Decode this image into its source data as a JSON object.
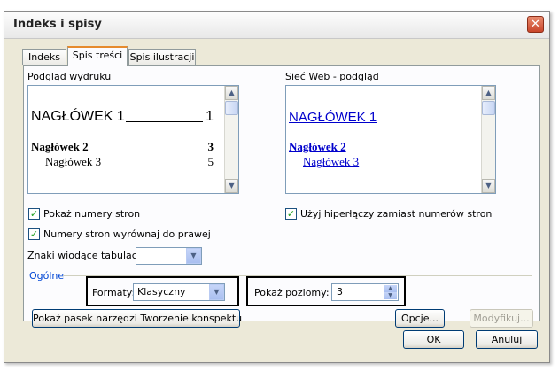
{
  "window": {
    "title": "Indeks i spisy",
    "close_glyph": "✕"
  },
  "tabs": [
    {
      "label": "Indeks",
      "active": false
    },
    {
      "label": "Spis treści",
      "active": true
    },
    {
      "label": "Spis ilustracji",
      "active": false
    }
  ],
  "print_preview": {
    "label": "Podgląd wydruku",
    "h1_text": "NAGŁÓWEK 1",
    "h1_page": "1",
    "h2_text": "Nagłówek 2",
    "h2_page": "3",
    "h3_text": "Nagłówek 3",
    "h3_page": "5"
  },
  "web_preview": {
    "label": "Sieć Web - podgląd",
    "h1_text": "NAGŁÓWEK 1",
    "h2_text": "Nagłówek 2",
    "h3_text": "Nagłówek 3",
    "link_color": "#0000cc"
  },
  "options": {
    "show_page_numbers": {
      "label": "Pokaż numery stron",
      "checked": true
    },
    "right_align": {
      "label": "Numery stron wyrównaj do prawej",
      "checked": true
    },
    "use_hyperlinks": {
      "label": "Użyj hiperłączy zamiast numerów stron",
      "checked": true
    },
    "tab_leader": {
      "label": "Znaki wiodące tabulacji:"
    }
  },
  "general": {
    "group_label": "Ogólne",
    "formats_label": "Formaty:",
    "formats_value": "Klasyczny",
    "levels_label": "Pokaż poziomy:",
    "levels_value": "3"
  },
  "buttons": {
    "outline_toolbar": "Pokaż pasek narzędzi Tworzenie konspektu",
    "options": "Opcje...",
    "modify": "Modyfikuj...",
    "ok": "OK",
    "cancel": "Anuluj"
  },
  "icons": {
    "check": "✓",
    "scroll_up": "▲",
    "scroll_down": "▼",
    "dropdown": "▼",
    "spin_up": "▲",
    "spin_down": "▼"
  },
  "colors": {
    "accent_tab": "#e68b2c",
    "group_label": "#0046d5",
    "highlight_box": "#000000"
  }
}
